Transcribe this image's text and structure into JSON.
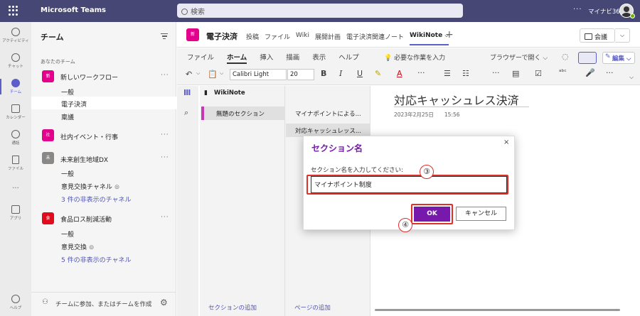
{
  "app": {
    "name": "Microsoft Teams",
    "user": "マイナビ365"
  },
  "search": {
    "placeholder": "検索"
  },
  "rail": [
    {
      "label": "アクティビティ",
      "icon": "bell-icon"
    },
    {
      "label": "チャット",
      "icon": "chat-icon"
    },
    {
      "label": "チーム",
      "icon": "teams-icon"
    },
    {
      "label": "カレンダー",
      "icon": "calendar-icon"
    },
    {
      "label": "通話",
      "icon": "phone-icon"
    },
    {
      "label": "ファイル",
      "icon": "file-icon"
    },
    {
      "label": "...",
      "icon": "more-icon"
    },
    {
      "label": "アプリ",
      "icon": "apps-icon"
    },
    {
      "label": "ヘルプ",
      "icon": "help-icon"
    }
  ],
  "teams_panel": {
    "title": "チーム",
    "section": "あなたのチーム",
    "teams": [
      {
        "avatar": "新",
        "name": "新しいワークフロー",
        "color": "#e3008c",
        "channels": [
          "一般",
          "電子決済",
          "稟議"
        ]
      },
      {
        "avatar": "社",
        "name": "社内イベント・行事",
        "color": "#e3008c",
        "channels": []
      },
      {
        "avatar": "未",
        "name": "未来創生地域DX",
        "color": "#8a8886",
        "channels": [
          "一般",
          "意見交換チャネル"
        ],
        "hidden": "3 件の非表示のチャネル"
      },
      {
        "avatar": "食",
        "name": "食品ロス削減活動",
        "color": "#e00b1c",
        "channels": [
          "一般",
          "意見交換"
        ],
        "hidden": "5 件の非表示のチャネル"
      }
    ],
    "join": "チームに参加、またはチームを作成"
  },
  "channel": {
    "avatar": "新",
    "title": "電子決済",
    "tabs": [
      "投稿",
      "ファイル",
      "Wiki",
      "展開計画",
      "電子決済関連ノート",
      "WikiNote"
    ],
    "meet": "会議"
  },
  "ribbon": {
    "menus": [
      "ファイル",
      "ホーム",
      "挿入",
      "描画",
      "表示",
      "ヘルプ"
    ],
    "tellme": "必要な作業を入力",
    "browser": "ブラウザーで開く",
    "edit": "編集",
    "font": "Calibri Light",
    "size": "20"
  },
  "onenote": {
    "notebook": "WikiNote",
    "section": "無題のセクション",
    "pages": [
      "マイナポイントによる...",
      "対応キャッシュレッス..."
    ],
    "add_section": "セクションの追加",
    "add_page": "ページの追加",
    "page_title": "対応キャッシュレス決済",
    "page_date": "2023年2月25日",
    "page_time": "15:56"
  },
  "dialog": {
    "title": "セクション名",
    "label": "セクション名を入力してください:",
    "value": "マイナポイント制度",
    "ok": "OK",
    "cancel": "キャンセル",
    "close": "×"
  },
  "markers": {
    "m3": "③",
    "m4": "④"
  }
}
